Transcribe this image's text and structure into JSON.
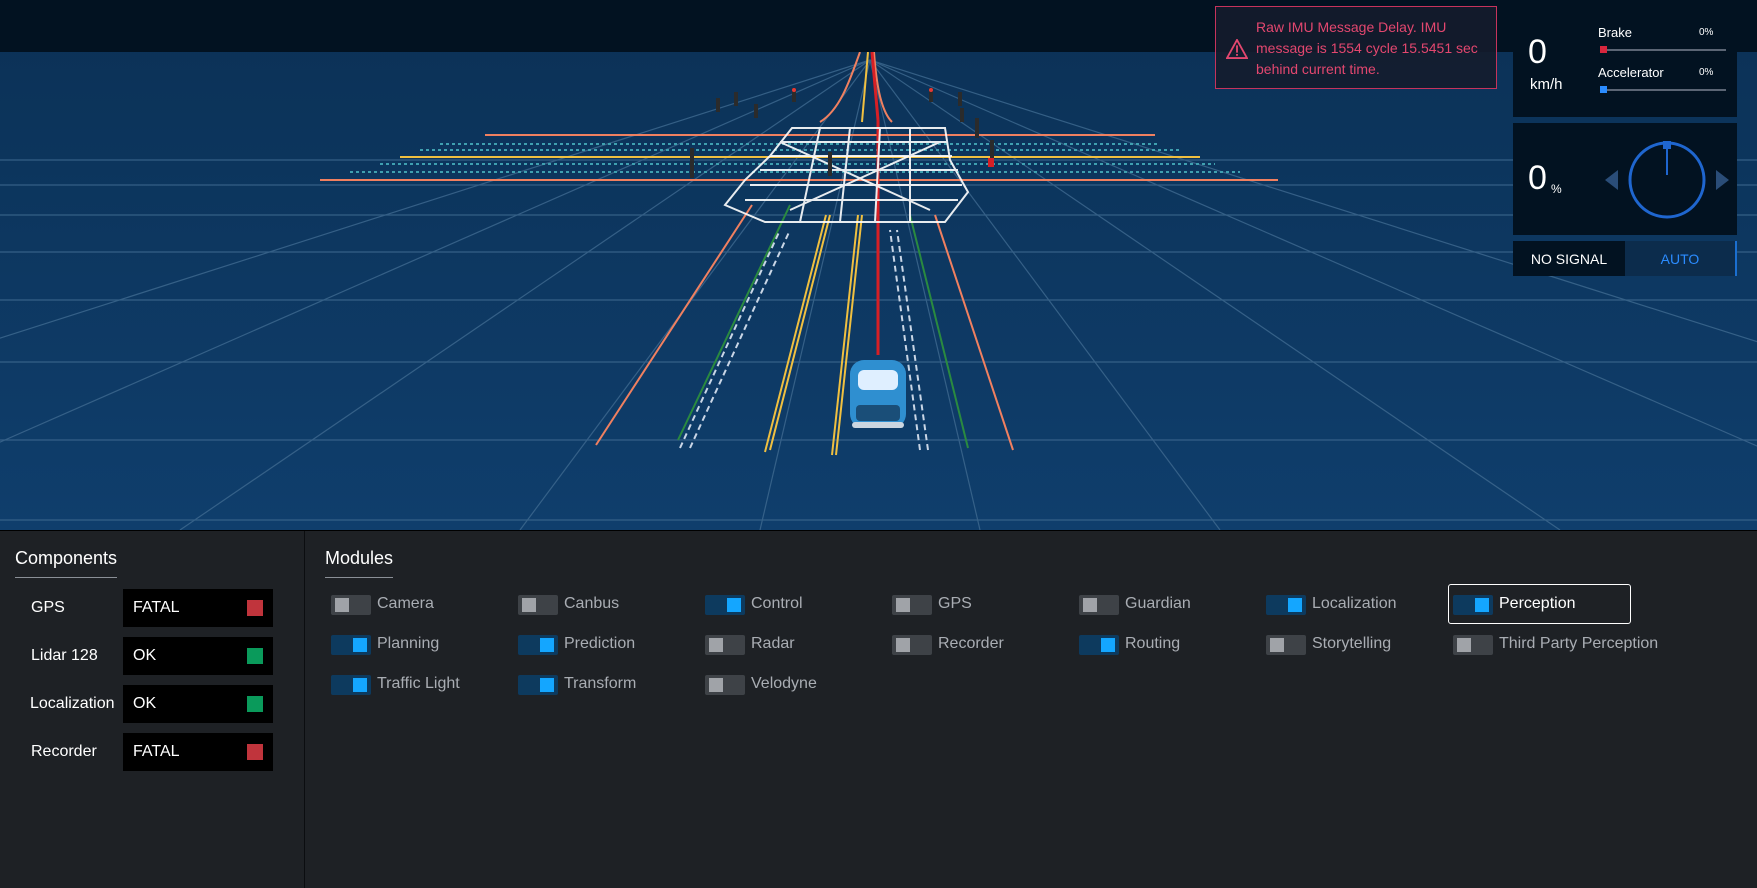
{
  "alert": {
    "message_line1": "Raw IMU Message Delay. IMU",
    "message_line2": "message is 1554 cycle 15.5451 sec",
    "message_line3": "behind current time.",
    "color": "#e3476f"
  },
  "speed_panel": {
    "speed_value": "0",
    "speed_unit": "km/h",
    "brake_label": "Brake",
    "brake_percent": "0%",
    "brake_level": 0,
    "accelerator_label": "Accelerator",
    "accelerator_percent": "0%",
    "accelerator_level": 0
  },
  "steering_panel": {
    "value": "0",
    "unit": "%"
  },
  "signal_bar": {
    "signal_label": "NO SIGNAL",
    "mode_label": "AUTO"
  },
  "components": {
    "title": "Components",
    "items": [
      {
        "name": "GPS",
        "status": "FATAL",
        "color": "#c0343c"
      },
      {
        "name": "Lidar 128",
        "status": "OK",
        "color": "#0a9a5b"
      },
      {
        "name": "Localization",
        "status": "OK",
        "color": "#0a9a5b"
      },
      {
        "name": "Recorder",
        "status": "FATAL",
        "color": "#c0343c"
      }
    ]
  },
  "modules": {
    "title": "Modules",
    "items": [
      {
        "label": "Camera",
        "on": false
      },
      {
        "label": "Canbus",
        "on": false
      },
      {
        "label": "Control",
        "on": true
      },
      {
        "label": "GPS",
        "on": false
      },
      {
        "label": "Guardian",
        "on": false
      },
      {
        "label": "Localization",
        "on": true
      },
      {
        "label": "Perception",
        "on": true,
        "focused": true
      },
      {
        "label": "Planning",
        "on": true
      },
      {
        "label": "Prediction",
        "on": true
      },
      {
        "label": "Radar",
        "on": false
      },
      {
        "label": "Recorder",
        "on": false
      },
      {
        "label": "Routing",
        "on": true
      },
      {
        "label": "Storytelling",
        "on": false
      },
      {
        "label": "Third Party Perception",
        "on": false
      },
      {
        "label": "Traffic Light",
        "on": true
      },
      {
        "label": "Transform",
        "on": true
      },
      {
        "label": "Velodyne",
        "on": false
      }
    ]
  }
}
